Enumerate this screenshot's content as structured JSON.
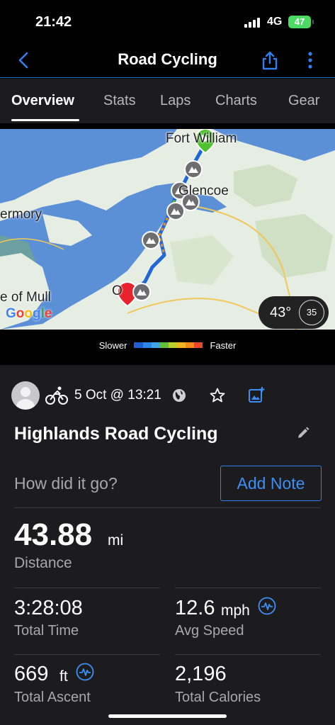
{
  "status_bar": {
    "time": "21:42",
    "network": "4G",
    "battery": "47"
  },
  "nav": {
    "title": "Road Cycling"
  },
  "tabs": [
    {
      "label": "Overview",
      "active": true
    },
    {
      "label": "Stats",
      "active": false
    },
    {
      "label": "Laps",
      "active": false
    },
    {
      "label": "Charts",
      "active": false
    },
    {
      "label": "Gear",
      "active": false
    }
  ],
  "map": {
    "labels": {
      "fort_william": "Fort William",
      "glencoe": "Glencoe",
      "tobermory": "ermory",
      "isle_of_mull": "e of Mull",
      "oban": "O"
    },
    "attribution": "Google",
    "temperature": "43°",
    "wind_speed": "35",
    "colors": {
      "water": "#5b8fd6",
      "land": "#e6ede3",
      "route_start": "#4cc22c",
      "route_end": "#e8232e"
    }
  },
  "legend": {
    "slower": "Slower",
    "faster": "Faster",
    "colors": [
      "#1e5fd6",
      "#2d86e8",
      "#3da6e8",
      "#5fbf3a",
      "#b9cf2e",
      "#f2b51d",
      "#f58a1f",
      "#e8492b"
    ]
  },
  "activity": {
    "date": "5 Oct @ 13:21",
    "title": "Highlands Road Cycling",
    "prompt": "How did it go?",
    "add_note": "Add Note"
  },
  "stats": {
    "distance": {
      "value": "43.88",
      "unit": "mi",
      "label": "Distance"
    },
    "total_time": {
      "value": "3:28:08",
      "label": "Total Time"
    },
    "avg_speed": {
      "value": "12.6",
      "unit": "mph",
      "label": "Avg Speed"
    },
    "total_ascent": {
      "value": "669",
      "unit": "ft",
      "label": "Total Ascent"
    },
    "total_calories": {
      "value": "2,196",
      "label": "Total Calories"
    }
  },
  "accent_color": "#2f80ed"
}
